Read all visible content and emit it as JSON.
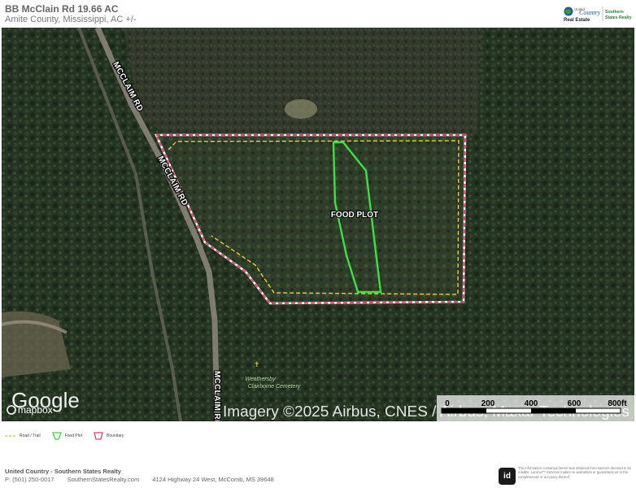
{
  "header": {
    "title": "BB McClain Rd 19.66 AC",
    "subtitle": "Amite County, Mississippi,  AC +/-"
  },
  "logo": {
    "brand_small": "United",
    "brand_main": "Country",
    "brand_sub": "Real Estate",
    "partner_line1": "Southern",
    "partner_line2": "States Realty"
  },
  "map": {
    "road_labels": [
      "MCCLAIM RD",
      "MCCLAIM RD",
      "MCCLAIM R"
    ],
    "plot_label": "FOOD PLOT",
    "cemetery_line1": "Weathersby",
    "cemetery_line2": "Clairborne Cemetery",
    "attribution_logo": "Google",
    "attribution_mapbox": "mapbox",
    "attribution_text": "Imagery ©2025 Airbus, CNES / Airbus, Maxar Technologies",
    "scale_ticks": [
      "0",
      "200",
      "400",
      "600",
      "800ft"
    ],
    "colors": {
      "boundary": "#e0406a",
      "food_plot": "#3fe03f",
      "trail": "#e8d23a"
    }
  },
  "legend": [
    {
      "label": "Road / Trail",
      "icon": "dashed-line-icon"
    },
    {
      "label": "Food Plot",
      "icon": "green-polygon-icon"
    },
    {
      "label": "Boundary",
      "icon": "pink-polygon-icon"
    }
  ],
  "footer": {
    "company": "United Country - Southern States Realty",
    "phone": "P: (501) 250-0017",
    "website": "SouthernStatesRealty.com",
    "address": "4124 Highway 24 West, McComb, MS 39648",
    "badge": "id",
    "disclaimer": "The information contained herein was obtained from sources deemed to be reliable. Land id™ Services makes no warranties or guarantees as to the completeness or accuracy thereof."
  }
}
